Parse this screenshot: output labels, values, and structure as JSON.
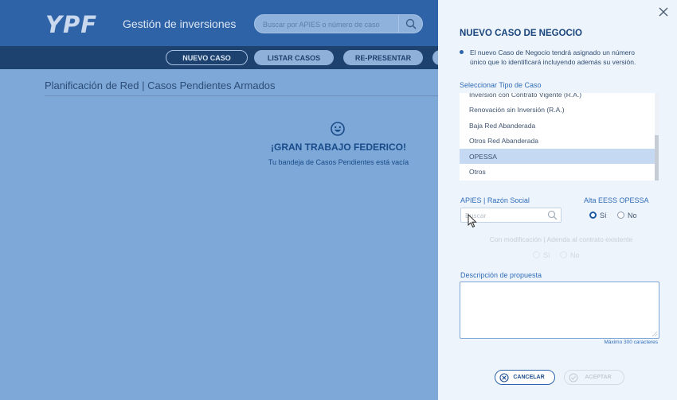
{
  "app": {
    "logo": "YPF",
    "title": "Gestión de inversiones",
    "search": {
      "placeholder": "Buscar por APIES o número de caso"
    }
  },
  "nav": {
    "items": [
      {
        "label": "NUEVO CASO"
      },
      {
        "label": "LISTAR CASOS"
      },
      {
        "label": "RE-PRESENTAR"
      }
    ]
  },
  "page": {
    "breadcrumb": "Planificación de Red | Casos Pendientes Armados",
    "empty_title": "¡GRAN TRABAJO FEDERICO!",
    "empty_subtitle": "Tu bandeja de Casos Pendientes está vacía"
  },
  "panel": {
    "title": "NUEVO CASO DE NEGOCIO",
    "info": "El nuevo Caso de Negocio tendrá asignado un número único que lo identificará incluyendo además su versión.",
    "case_type_label": "Seleccionar Tipo de Caso",
    "case_types": [
      "Inversión con Contrato Vigente (R.A.)",
      "Renovación sin Inversión (R.A.)",
      "Baja Red Abanderada",
      "Otros Red Abanderada",
      "OPESSA",
      "Otros"
    ],
    "selected_case_type": "OPESSA",
    "apies_label": "APIES | Razón Social",
    "apies_placeholder": "Buscar",
    "alta_label": "Alta EESS OPESSA",
    "alta_yes": "Sí",
    "alta_no": "No",
    "alta_value": "Sí",
    "modification_label": "Con modificación | Adenda al contrato existente",
    "mod_yes": "Sí",
    "mod_no": "No",
    "description_label": "Descripción de propuesta",
    "description_value": "",
    "max_chars": "Máximo 300 caracteres",
    "cancel_label": "CANCELAR",
    "accept_label": "ACEPTAR"
  },
  "colors": {
    "primary": "#2b63ad",
    "header": "#2f63a7",
    "navbar": "#1e426f",
    "panel_bg": "#eef4fb",
    "selected_row": "#c5d9f2"
  }
}
